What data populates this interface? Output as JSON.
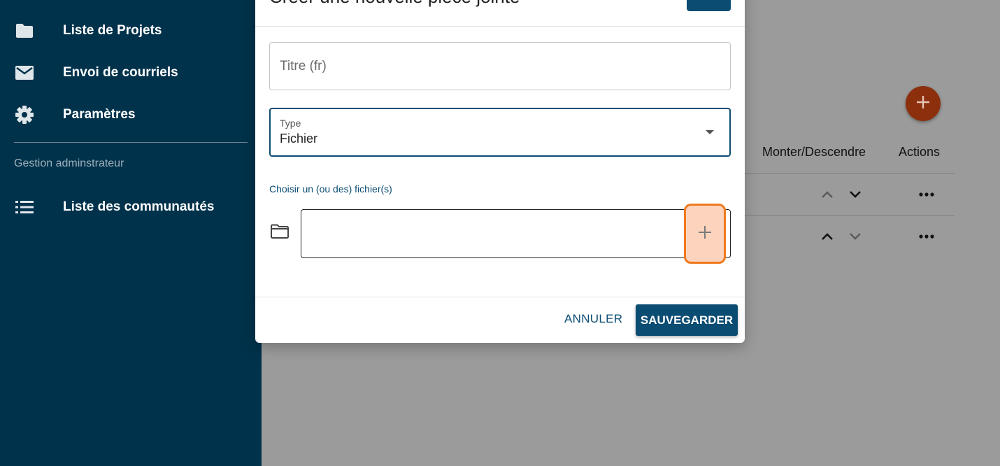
{
  "sidebar": {
    "items": [
      {
        "label": "Liste de Projets",
        "icon": "folder-icon"
      },
      {
        "label": "Envoi de courriels",
        "icon": "mail-icon"
      },
      {
        "label": "Paramètres",
        "icon": "gear-icon"
      }
    ],
    "section_label": "Gestion adminstrateur",
    "admin_items": [
      {
        "label": "Liste des communautés",
        "icon": "list-icon"
      }
    ]
  },
  "background_table": {
    "columns": [
      "Monter/Descendre",
      "Actions"
    ],
    "rows": 2
  },
  "dialog": {
    "title": "Créer une nouvelle pièce jointe",
    "titre_field": {
      "placeholder": "Titre (fr)",
      "value": ""
    },
    "type_field": {
      "label": "Type",
      "value": "Fichier"
    },
    "file_label": "Choisir un (ou des) fichier(s)",
    "cancel_label": "ANNULER",
    "save_label": "SAUVEGARDER"
  },
  "colors": {
    "sidebar": "#01324b",
    "primary": "#0b4c73",
    "fab": "#8b2f0d",
    "highlight_border": "#f07a1e",
    "highlight_fill": "#fcd3bd"
  }
}
